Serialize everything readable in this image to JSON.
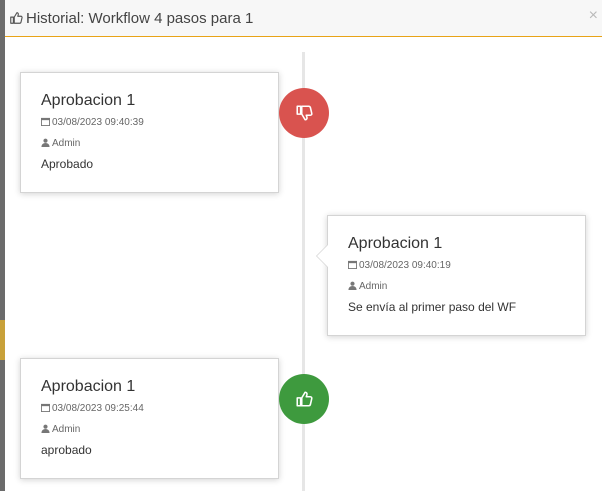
{
  "modal": {
    "title": "Historial: Workflow 4 pasos para 1",
    "close_label": "×"
  },
  "timeline": [
    {
      "title": "Aprobacion 1",
      "date": "03/08/2023 09:40:39",
      "user": "Admin",
      "comment": "Aprobado",
      "side": "left",
      "badge": {
        "icon": "thumbs-down-icon",
        "color": "#d9534f"
      }
    },
    {
      "title": "Aprobacion 1",
      "date": "03/08/2023 09:40:19",
      "user": "Admin",
      "comment": "Se envía al primer paso del WF",
      "side": "right",
      "badge": null
    },
    {
      "title": "Aprobacion 1",
      "date": "03/08/2023 09:25:44",
      "user": "Admin",
      "comment": "aprobado",
      "side": "left",
      "badge": {
        "icon": "thumbs-up-icon",
        "color": "#3e9a3e"
      }
    }
  ]
}
